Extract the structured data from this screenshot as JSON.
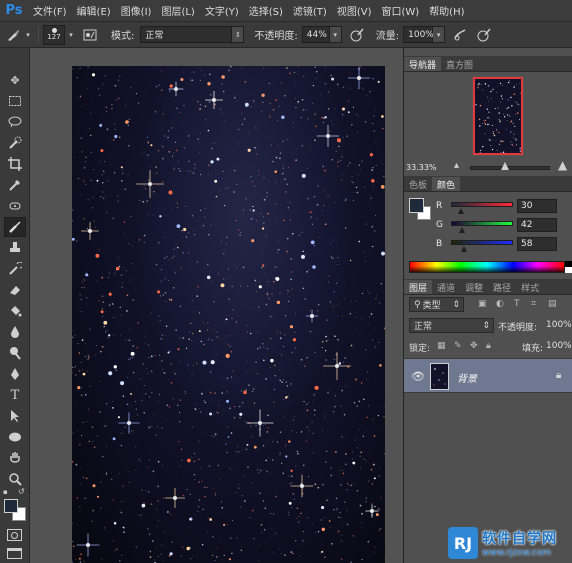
{
  "app": {
    "logo": "Ps"
  },
  "menu": [
    "文件(F)",
    "编辑(E)",
    "图像(I)",
    "图层(L)",
    "文字(Y)",
    "选择(S)",
    "滤镜(T)",
    "视图(V)",
    "窗口(W)",
    "帮助(H)"
  ],
  "options": {
    "brush_size": "127",
    "mode_label": "模式:",
    "mode_value": "正常",
    "opacity_label": "不透明度:",
    "opacity_value": "44%",
    "flow_label": "流量:",
    "flow_value": "100%"
  },
  "tools": [
    "move-icon",
    "marquee-icon",
    "lasso-icon",
    "quick-selection-icon",
    "crop-icon",
    "eyedropper-icon",
    "healing-icon",
    "brush-icon",
    "stamp-icon",
    "history-brush-icon",
    "eraser-icon",
    "paint-bucket-icon",
    "blur-icon",
    "dodge-icon",
    "pen-icon",
    "type-icon",
    "path-selection-icon",
    "ellipse-icon",
    "hand-icon",
    "zoom-icon"
  ],
  "active_tool": "brush-icon",
  "colors": {
    "foreground": "#1e2a3a",
    "background": "#ffffff",
    "accent": "#e2373b",
    "layer_selected": "#6e7891"
  },
  "navigator": {
    "tabs": [
      "导航器",
      "直方图"
    ],
    "zoom": "33.33%"
  },
  "color_panel": {
    "tabs": [
      "色板",
      "颜色"
    ],
    "r_label": "R",
    "r_value": "30",
    "g_label": "G",
    "g_value": "42",
    "b_label": "B",
    "b_value": "58"
  },
  "layers_panel": {
    "tabs": [
      "图层",
      "通道",
      "调整",
      "路径",
      "样式"
    ],
    "filter_type": "类型",
    "blend_mode": "正常",
    "opacity_label": "不透明度:",
    "opacity_value": "100%",
    "lock_label": "锁定:",
    "fill_label": "填充:",
    "fill_value": "100%",
    "layer_name": "背景"
  },
  "watermark": {
    "logo": "RJ",
    "name": "软件自学网",
    "url": "www.rjzxw.com"
  }
}
